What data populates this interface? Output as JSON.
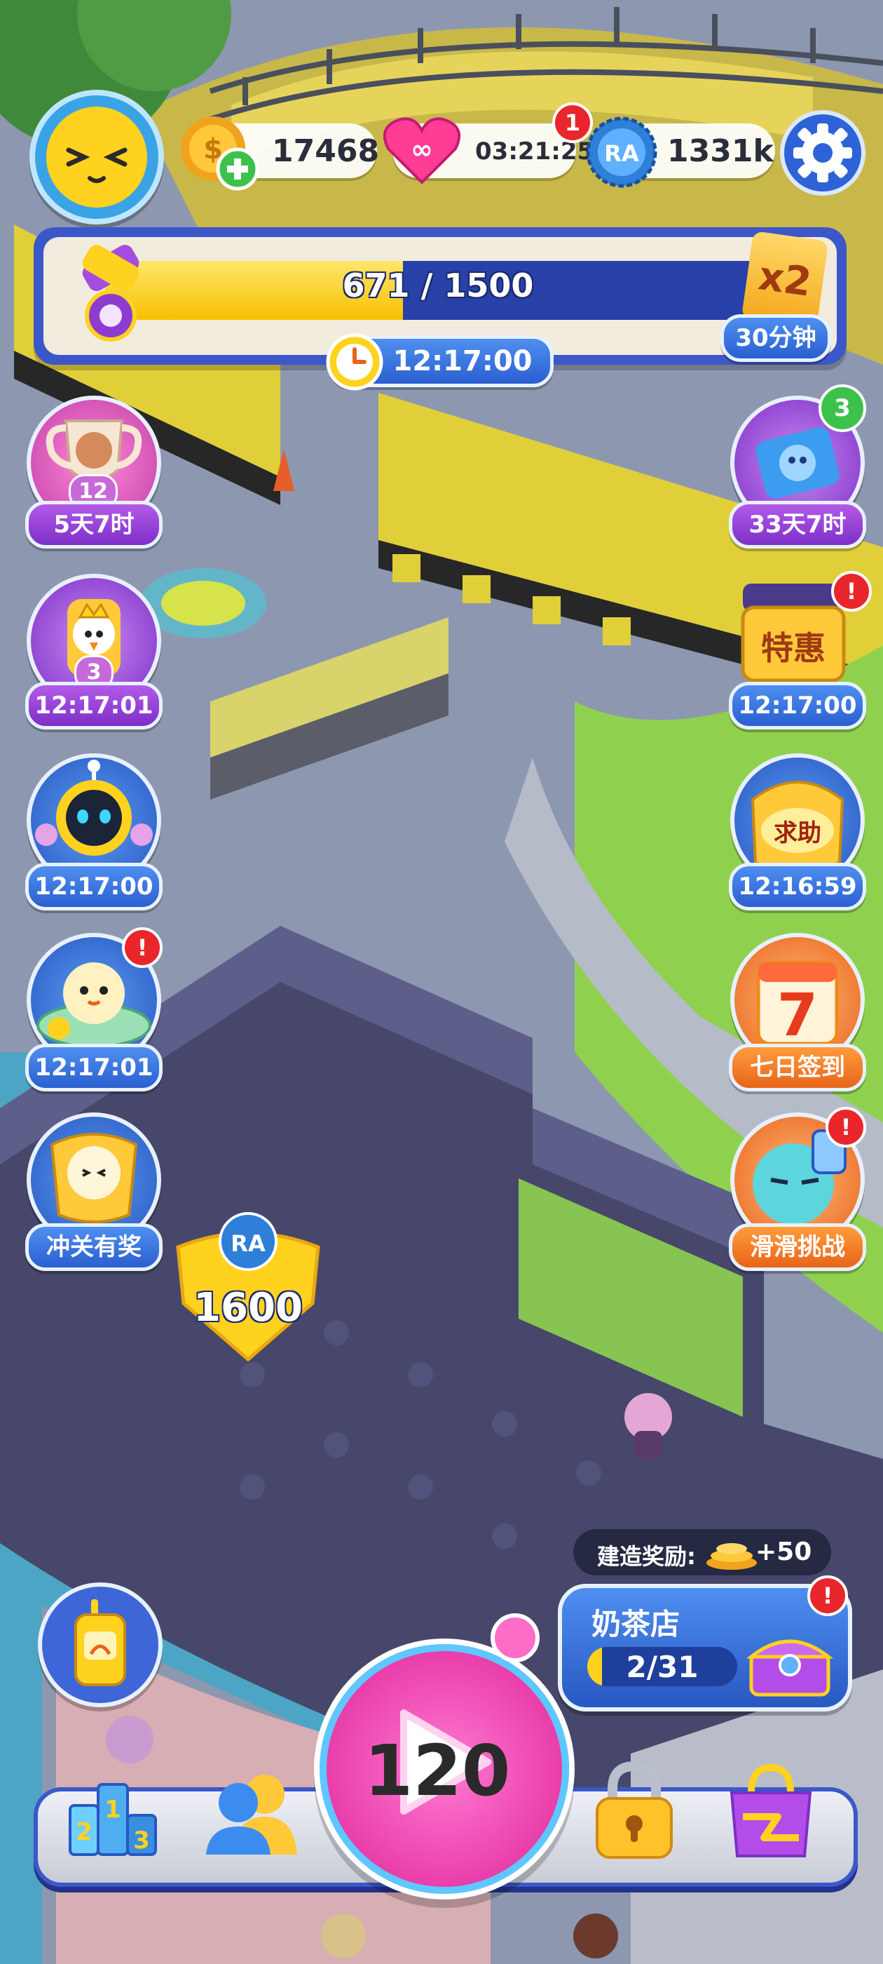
{
  "top_bar": {
    "coins": "17468",
    "lives_timer": "03:21:25",
    "lives_badge": "1",
    "caps": "1331k"
  },
  "progress": {
    "value_text": "671 / 1500",
    "current": 671,
    "max": 1500,
    "multiplier": "x2",
    "multiplier_duration": "30分钟",
    "timer": "12:17:00"
  },
  "left_events": [
    {
      "label": "5天7时",
      "sub": "12",
      "icon": "trophy-icon"
    },
    {
      "label": "12:17:01",
      "sub": "3",
      "icon": "bird-king-icon"
    },
    {
      "label": "12:17:00",
      "icon": "robot-icon"
    },
    {
      "label": "12:17:01",
      "icon": "turtle-chick-icon"
    },
    {
      "label": "冲关有奖",
      "icon": "mascot-icon"
    }
  ],
  "right_events": [
    {
      "label": "33天7时",
      "badge": "3",
      "icon": "ticket-icon"
    },
    {
      "label": "12:17:00",
      "text": "特惠",
      "icon": "special-offer-icon"
    },
    {
      "label": "12:16:59",
      "text": "求助",
      "icon": "help-icon"
    },
    {
      "label": "七日签到",
      "text": "7",
      "icon": "calendar-icon"
    },
    {
      "label": "滑滑挑战",
      "icon": "slide-challenge-icon"
    }
  ],
  "world": {
    "cap_reward": "1600"
  },
  "build": {
    "reward_label": "建造奖励:",
    "reward_value": "+50",
    "shop_name": "奶茶店",
    "shop_progress": "2/31",
    "shop_current": 2,
    "shop_max": 31
  },
  "play": {
    "level": "120"
  },
  "bottom_nav": {
    "ranking_digits": [
      "2",
      "1",
      "3"
    ],
    "items": [
      "ranking-icon",
      "friends-icon",
      "play-button",
      "locked-icon",
      "shop-bag-icon"
    ]
  },
  "colors": {
    "accent_blue": "#3b57c9",
    "progress_yellow": "#ffd21f",
    "play_pink": "#ff3fb4",
    "badge_red": "#e8262b"
  }
}
